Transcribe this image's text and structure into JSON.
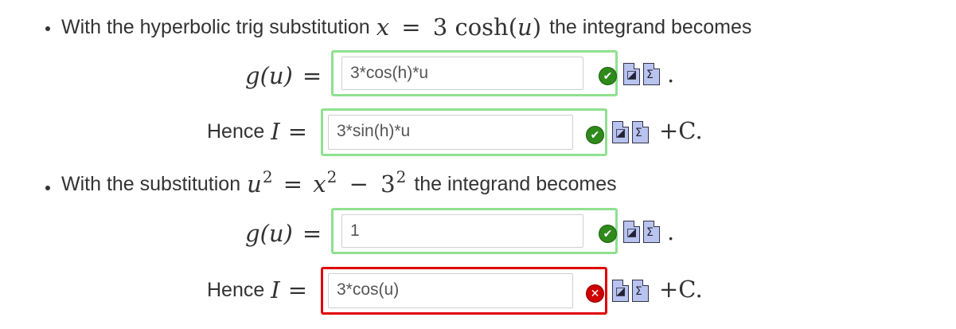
{
  "step1": {
    "text_before": "With the hyperbolic trig substitution",
    "sub_lhs": "x",
    "eq": "=",
    "sub_rhs": "3 cosh(",
    "sub_var": "u",
    "sub_close": ")",
    "text_after": "the integrand becomes",
    "g_lhs": "g(u)",
    "g_eq": "=",
    "g_input_value": "3*cos(h)*u",
    "g_status": "correct",
    "g_trail": ".",
    "hence_label": "Hence",
    "hence_var": "I",
    "hence_eq": "=",
    "hence_input_value": "3*sin(h)*u",
    "hence_status": "correct",
    "hence_trail": "+C."
  },
  "step2": {
    "text_before": "With the substitution",
    "u": "u",
    "x": "x",
    "three": "3",
    "exp": "2",
    "eq": "=",
    "minus": "−",
    "text_after": "the integrand becomes",
    "g_lhs": "g(u)",
    "g_eq": "=",
    "g_input_value": "1",
    "g_status": "correct",
    "g_trail": ".",
    "hence_label": "Hence",
    "hence_var": "I",
    "hence_eq": "=",
    "hence_input_value": "3*cos(u)",
    "hence_status": "incorrect",
    "hence_trail": "+C."
  },
  "icons": {
    "correct": "check-circle-icon",
    "incorrect": "x-circle-icon",
    "preview": "preview-icon",
    "equation_editor": "equation-editor-icon"
  },
  "colors": {
    "correct_border": "#90e090",
    "incorrect_border": "#e00000",
    "correct_icon": "#2f8a1b",
    "incorrect_icon": "#d00000",
    "tool_icon_fill": "#b9c3ef"
  }
}
